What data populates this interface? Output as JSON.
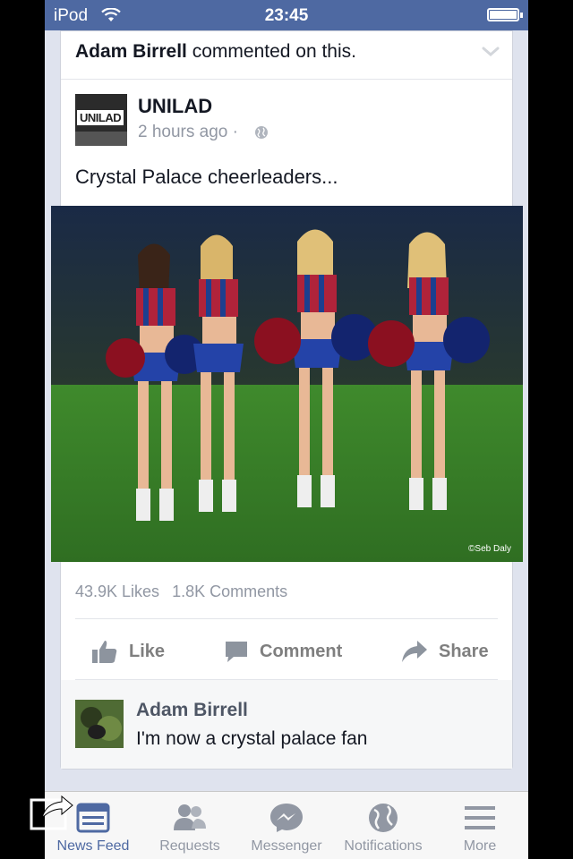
{
  "status_bar": {
    "carrier": "iPod",
    "time": "23:45"
  },
  "story": {
    "actor": "Adam Birrell",
    "action": "commented on this.",
    "page_name": "UNILAD",
    "avatar_logo_text": "UNILAD",
    "time": "2 hours ago",
    "time_separator": "·",
    "text": "Crystal Palace cheerleaders...",
    "photo_credit": "©Seb Daly",
    "stats": {
      "likes": "43.9K Likes",
      "comments": "1.8K Comments"
    },
    "actions": {
      "like": "Like",
      "comment": "Comment",
      "share": "Share"
    },
    "comment": {
      "author": "Adam Birrell",
      "text": "I'm now a crystal palace fan"
    }
  },
  "tabs": [
    {
      "label": "News Feed",
      "icon": "news-feed-icon",
      "active": true
    },
    {
      "label": "Requests",
      "icon": "friend-requests-icon",
      "active": false
    },
    {
      "label": "Messenger",
      "icon": "messenger-icon",
      "active": false
    },
    {
      "label": "Notifications",
      "icon": "globe-icon",
      "active": false
    },
    {
      "label": "More",
      "icon": "menu-icon",
      "active": false
    }
  ],
  "colors": {
    "brand": "#4e69a2",
    "active_tab": "#4e69a2",
    "inactive": "#9197a3"
  }
}
